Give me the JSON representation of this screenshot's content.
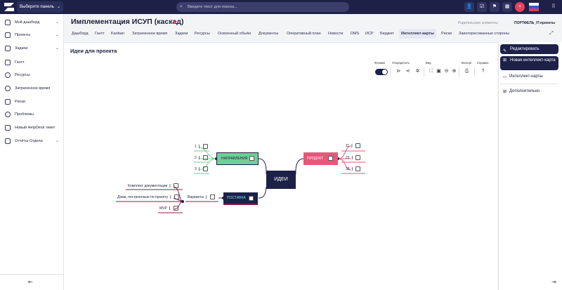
{
  "topbar": {
    "panel_select": "Выберите панель",
    "search_placeholder": "Введите текст для поиска...",
    "icons": [
      "user-icon",
      "checklist-icon",
      "flag-icon",
      "calendar-icon",
      "plus-icon",
      "language-flag-icon",
      "apps-grid-icon"
    ],
    "colors": {
      "bar": "#1d2147",
      "plus": "#ef3e5c"
    }
  },
  "sidebar": {
    "items": [
      {
        "label": "Мой дашборд",
        "icon": "dashboard-icon",
        "has_chevron": true
      },
      {
        "label": "Проекты",
        "icon": "folder-icon",
        "has_chevron": true
      },
      {
        "label": "Задачи",
        "icon": "tasks-icon",
        "has_chevron": true
      },
      {
        "label": "Гантт",
        "icon": "gantt-icon",
        "has_chevron": false
      },
      {
        "label": "Ресурсы",
        "icon": "person-icon",
        "has_chevron": false
      },
      {
        "label": "Затраченное время",
        "icon": "clock-icon",
        "has_chevron": false
      },
      {
        "label": "Риски",
        "icon": "megaphone-icon",
        "has_chevron": false
      },
      {
        "label": "Проблемы",
        "icon": "warning-icon",
        "has_chevron": false
      },
      {
        "label": "Новый HelpDesk тикет",
        "icon": "ticket-icon",
        "has_chevron": false
      },
      {
        "label": "Отчёты Отдела",
        "icon": "report-icon",
        "has_chevron": true
      }
    ]
  },
  "header": {
    "title": "Имплементация ИСУП (каскад)",
    "parent_label": "Родительские элементы:",
    "parent_value": "ПОРТФЕЛЬ_IT-проекты"
  },
  "tabs": [
    "Дашборд",
    "Гантт",
    "Kanban",
    "Затраченное время",
    "Задачи",
    "Ресурсы",
    "Освоенный объём",
    "Документы",
    "Оперативный план",
    "Новости",
    "DMS",
    "ИСР",
    "Бюджет",
    "Интеллект-карты",
    "Риски",
    "Заинтересованные стороны"
  ],
  "active_tab": "Интеллект-карты",
  "canvas": {
    "title": "Идеи для проекта",
    "toolbar": {
      "flow_label": "Флажки",
      "arrange_label": "Упорядочить",
      "view_label": "Вид",
      "export_label": "Экспорт",
      "help_label": "Справка",
      "flow_on": true
    }
  },
  "mindmap": {
    "center": "ИДЕИ",
    "branches": {
      "napravleniya": {
        "label": "НАПРАВЛЕНИЯ",
        "children": [
          "1",
          "2",
          "3"
        ],
        "color": "#6fcf97"
      },
      "produkt": {
        "label": "ПРОДУКТ",
        "children": [
          "11",
          "22",
          "33"
        ],
        "color": "#e8577a"
      },
      "postavka": {
        "label": "ПОСТАВКА",
        "color": "#1d2147"
      },
      "varianty": {
        "label": "Варианты",
        "children": [
          "Комплект документации",
          "Дома, построенные по проекту",
          "MVP"
        ]
      }
    }
  },
  "right_panel": {
    "edit": "Редактировать",
    "new_map": "Новая интеллект-карта",
    "maps_link": "Интеллект-карты",
    "more": "Дополнительно"
  }
}
